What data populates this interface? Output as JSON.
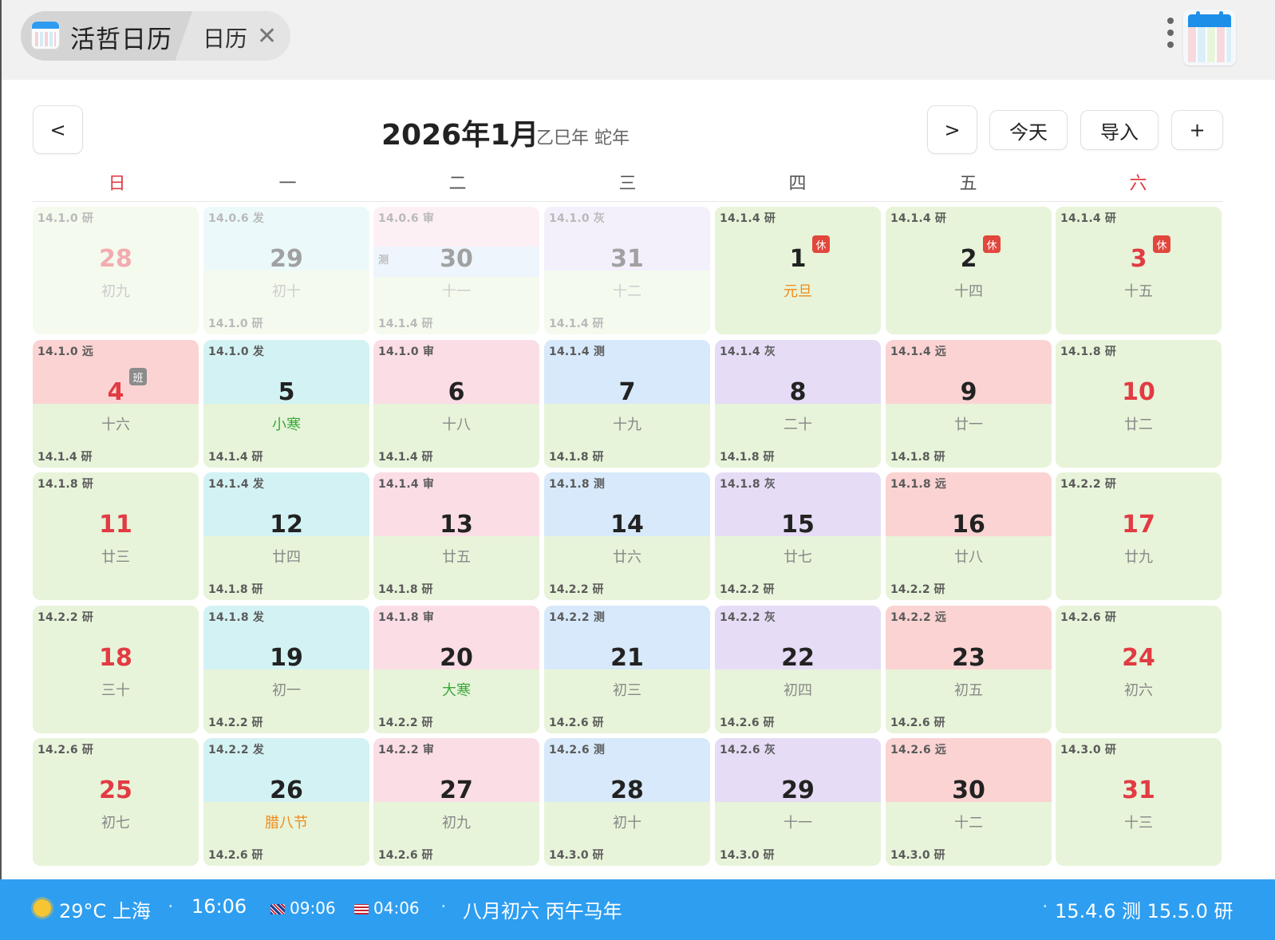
{
  "app": {
    "tab_title": "活哲日历",
    "tab_secondary": "日历",
    "close_icon": "close-icon",
    "menu_icon": "more-vertical-icon",
    "calendar_icon": "calendar-icon"
  },
  "header": {
    "prev_label": "<",
    "next_label": ">",
    "today_label": "今天",
    "import_label": "导入",
    "add_label": "+",
    "month_title": "2026年1月",
    "ganzhi": "乙巳年 蛇年"
  },
  "weekdays": [
    "日",
    "一",
    "二",
    "三",
    "四",
    "五",
    "六"
  ],
  "colors": {
    "accent": "#2e9ef1",
    "weekend_red": "#e23b43",
    "green": "#e7f4d9",
    "cyan": "#d3f2f4",
    "pink": "#fbdde6",
    "blue": "#d7e9fa",
    "purple": "#e6dcf6",
    "red": "#fbd3d3"
  },
  "weeks": [
    [
      {
        "day": "28",
        "lunar": "初九",
        "top": "14.1.0 研",
        "bottom": "",
        "color": "green",
        "dim": true,
        "red": true
      },
      {
        "day": "29",
        "lunar": "初十",
        "top": "14.0.6 发",
        "bottom": "14.1.0 研",
        "color": "cyan",
        "dim": true
      },
      {
        "day": "30",
        "lunar": "十一",
        "top": "14.0.6 审",
        "bottom": "14.1.4 研",
        "color": "pink",
        "mid": "测",
        "mid_color": "blue",
        "dim": true
      },
      {
        "day": "31",
        "lunar": "十二",
        "top": "14.1.0 灰",
        "bottom": "14.1.4 研",
        "color": "purple",
        "dim": true
      },
      {
        "day": "1",
        "lunar": "元旦",
        "lunar_type": "fest",
        "top": "14.1.4 研",
        "bottom": "",
        "color": "green",
        "badge": "休",
        "badge_type": "rest"
      },
      {
        "day": "2",
        "lunar": "十四",
        "top": "14.1.4 研",
        "bottom": "",
        "color": "green",
        "badge": "休",
        "badge_type": "rest"
      },
      {
        "day": "3",
        "lunar": "十五",
        "top": "14.1.4 研",
        "bottom": "",
        "color": "green",
        "red": true,
        "badge": "休",
        "badge_type": "rest"
      }
    ],
    [
      {
        "day": "4",
        "lunar": "十六",
        "top": "14.1.0 远",
        "bottom": "14.1.4 研",
        "color": "red",
        "red": true,
        "badge": "班",
        "badge_type": "work"
      },
      {
        "day": "5",
        "lunar": "小寒",
        "lunar_type": "term",
        "top": "14.1.0 发",
        "bottom": "14.1.4 研",
        "color": "cyan"
      },
      {
        "day": "6",
        "lunar": "十八",
        "top": "14.1.0 审",
        "bottom": "14.1.4 研",
        "color": "pink"
      },
      {
        "day": "7",
        "lunar": "十九",
        "top": "14.1.4 测",
        "bottom": "14.1.8 研",
        "color": "blue"
      },
      {
        "day": "8",
        "lunar": "二十",
        "top": "14.1.4 灰",
        "bottom": "14.1.8 研",
        "color": "purple"
      },
      {
        "day": "9",
        "lunar": "廿一",
        "top": "14.1.4 远",
        "bottom": "14.1.8 研",
        "color": "red"
      },
      {
        "day": "10",
        "lunar": "廿二",
        "top": "14.1.8 研",
        "bottom": "",
        "color": "green",
        "red": true
      }
    ],
    [
      {
        "day": "11",
        "lunar": "廿三",
        "top": "14.1.8 研",
        "bottom": "",
        "color": "green",
        "red": true
      },
      {
        "day": "12",
        "lunar": "廿四",
        "top": "14.1.4 发",
        "bottom": "14.1.8 研",
        "color": "cyan"
      },
      {
        "day": "13",
        "lunar": "廿五",
        "top": "14.1.4 审",
        "bottom": "14.1.8 研",
        "color": "pink"
      },
      {
        "day": "14",
        "lunar": "廿六",
        "top": "14.1.8 测",
        "bottom": "14.2.2 研",
        "color": "blue"
      },
      {
        "day": "15",
        "lunar": "廿七",
        "top": "14.1.8 灰",
        "bottom": "14.2.2 研",
        "color": "purple"
      },
      {
        "day": "16",
        "lunar": "廿八",
        "top": "14.1.8 远",
        "bottom": "14.2.2 研",
        "color": "red"
      },
      {
        "day": "17",
        "lunar": "廿九",
        "top": "14.2.2 研",
        "bottom": "",
        "color": "green",
        "red": true
      }
    ],
    [
      {
        "day": "18",
        "lunar": "三十",
        "top": "14.2.2 研",
        "bottom": "",
        "color": "green",
        "red": true
      },
      {
        "day": "19",
        "lunar": "初一",
        "top": "14.1.8 发",
        "bottom": "14.2.2 研",
        "color": "cyan"
      },
      {
        "day": "20",
        "lunar": "大寒",
        "lunar_type": "term",
        "top": "14.1.8 审",
        "bottom": "14.2.2 研",
        "color": "pink"
      },
      {
        "day": "21",
        "lunar": "初三",
        "top": "14.2.2 测",
        "bottom": "14.2.6 研",
        "color": "blue"
      },
      {
        "day": "22",
        "lunar": "初四",
        "top": "14.2.2 灰",
        "bottom": "14.2.6 研",
        "color": "purple"
      },
      {
        "day": "23",
        "lunar": "初五",
        "top": "14.2.2 远",
        "bottom": "14.2.6 研",
        "color": "red"
      },
      {
        "day": "24",
        "lunar": "初六",
        "top": "14.2.6 研",
        "bottom": "",
        "color": "green",
        "red": true
      }
    ],
    [
      {
        "day": "25",
        "lunar": "初七",
        "top": "14.2.6 研",
        "bottom": "",
        "color": "green",
        "red": true
      },
      {
        "day": "26",
        "lunar": "腊八节",
        "lunar_type": "fest",
        "top": "14.2.2 发",
        "bottom": "14.2.6 研",
        "color": "cyan"
      },
      {
        "day": "27",
        "lunar": "初九",
        "top": "14.2.2 审",
        "bottom": "14.2.6 研",
        "color": "pink"
      },
      {
        "day": "28",
        "lunar": "初十",
        "top": "14.2.6 测",
        "bottom": "14.3.0 研",
        "color": "blue"
      },
      {
        "day": "29",
        "lunar": "十一",
        "top": "14.2.6 灰",
        "bottom": "14.3.0 研",
        "color": "purple"
      },
      {
        "day": "30",
        "lunar": "十二",
        "top": "14.2.6 远",
        "bottom": "14.3.0 研",
        "color": "red"
      },
      {
        "day": "31",
        "lunar": "十三",
        "top": "14.3.0 研",
        "bottom": "",
        "color": "green",
        "red": true
      }
    ]
  ],
  "status": {
    "weather_icon": "sun-icon",
    "weather": "29°C 上海",
    "local_time": "16:06",
    "uk_time": "09:06",
    "us_time": "04:06",
    "lunar_date": "八月初六 丙午马年",
    "versions": "15.4.6 测 15.5.0 研",
    "separator": "·"
  }
}
